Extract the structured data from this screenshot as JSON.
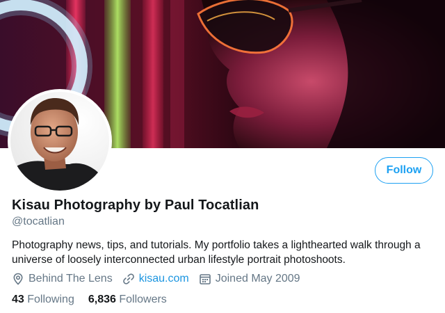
{
  "profile": {
    "display_name": "Kisau Photography by Paul Tocatlian",
    "handle": "@tocatlian",
    "bio": "Photography news, tips, and tutorials. My portfolio takes a lighthearted walk through a universe of loosely interconnected urban lifestyle portrait photoshoots.",
    "location": "Behind The Lens",
    "website": "kisau.com",
    "joined": "Joined May 2009"
  },
  "actions": {
    "follow_label": "Follow"
  },
  "stats": {
    "following_count": "43",
    "following_label": "Following",
    "followers_count": "6,836",
    "followers_label": "Followers"
  },
  "icons": {
    "location": "location-pin-icon",
    "website": "link-icon",
    "joined": "calendar-icon"
  },
  "colors": {
    "accent": "#1da1f2",
    "link": "#1b95e0",
    "secondary_text": "#657786",
    "primary_text": "#14171a"
  }
}
